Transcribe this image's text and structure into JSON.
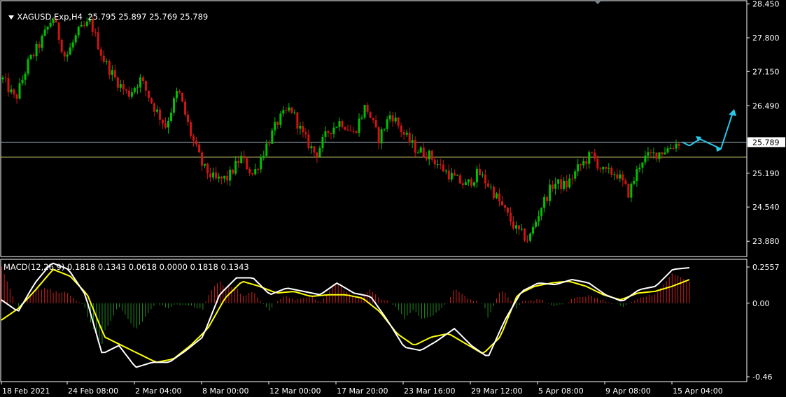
{
  "header": {
    "symbol": "XAGUSD.Exp,H4",
    "ohlc": "25.795 25.897 25.769 25.789",
    "macd": "MACD(12,26,9) 0.1818 0.1343 0.0618 0.0000 0.1818 0.1343"
  },
  "colors": {
    "background": "#000000",
    "frame": "#ffffff",
    "bull": "#00c000",
    "bear": "#d01414",
    "hist_up": "#d22020",
    "hist_down": "#1c8c1c",
    "macd_line": "#ffffff",
    "signal_line": "#ffff00",
    "forecast": "#29c8e8",
    "price_line": "#8fa5b5",
    "level_line": "#d8d870"
  },
  "chart_data": [
    {
      "type": "candlestick",
      "symbol": "XAGUSD.Exp",
      "timeframe": "H4",
      "ylim": [
        23.6,
        28.5
      ],
      "y_ticks": [
        "28.450",
        "27.800",
        "27.150",
        "26.490",
        "25.190",
        "24.540",
        "23.880"
      ],
      "current_price": "25.789",
      "level_line": 25.5,
      "x_ticks": [
        "18 Feb 2021",
        "24 Feb 08:00",
        "2 Mar 04:00",
        "8 Mar 00:00",
        "12 Mar 00:00",
        "17 Mar 20:00",
        "23 Mar 16:00",
        "29 Mar 12:00",
        "5 Apr 08:00",
        "9 Apr 08:00",
        "15 Apr 04:00"
      ],
      "close_path": [
        27.0,
        26.6,
        27.3,
        27.7,
        28.2,
        27.4,
        27.9,
        28.1,
        27.4,
        27.0,
        26.7,
        27.0,
        26.5,
        26.1,
        26.8,
        25.95,
        25.3,
        25.05,
        25.1,
        25.5,
        25.15,
        25.7,
        26.2,
        26.45,
        25.9,
        25.55,
        26.0,
        26.2,
        25.95,
        26.5,
        25.85,
        26.35,
        25.95,
        25.65,
        25.55,
        25.3,
        25.1,
        24.95,
        25.2,
        24.9,
        24.5,
        24.1,
        23.9,
        24.55,
        25.0,
        24.95,
        25.3,
        25.55,
        25.2,
        25.2,
        24.8,
        25.45,
        25.55,
        25.65,
        25.789
      ],
      "forecast_path": [
        25.789,
        25.72,
        25.85,
        25.66,
        26.4
      ]
    },
    {
      "type": "macd",
      "params": "12,26,9",
      "ylim": [
        -0.46,
        0.2557
      ],
      "y_ticks": [
        "0.2557",
        "0.00",
        "-0.46"
      ],
      "macd_path": [
        0.02,
        -0.05,
        0.12,
        0.24,
        0.2,
        0.05,
        -0.3,
        -0.25,
        -0.38,
        -0.35,
        -0.35,
        -0.28,
        -0.2,
        0.05,
        0.15,
        0.15,
        0.05,
        0.09,
        0.07,
        0.05,
        0.12,
        0.06,
        0.04,
        -0.1,
        -0.26,
        -0.28,
        -0.22,
        -0.15,
        -0.25,
        -0.32,
        -0.1,
        0.07,
        0.12,
        0.11,
        0.14,
        0.12,
        0.05,
        0.01,
        0.08,
        0.1,
        0.2,
        0.21
      ],
      "signal_path": [
        -0.1,
        -0.03,
        0.08,
        0.2,
        0.16,
        0.05,
        -0.2,
        -0.25,
        -0.3,
        -0.35,
        -0.33,
        -0.25,
        -0.15,
        0.03,
        0.13,
        0.1,
        0.06,
        0.07,
        0.04,
        0.05,
        0.05,
        0.03,
        -0.05,
        -0.18,
        -0.25,
        -0.2,
        -0.18,
        -0.24,
        -0.3,
        -0.2,
        0.05,
        0.1,
        0.12,
        0.13,
        0.1,
        0.05,
        0.02,
        0.06,
        0.07,
        0.1,
        0.14
      ]
    }
  ]
}
